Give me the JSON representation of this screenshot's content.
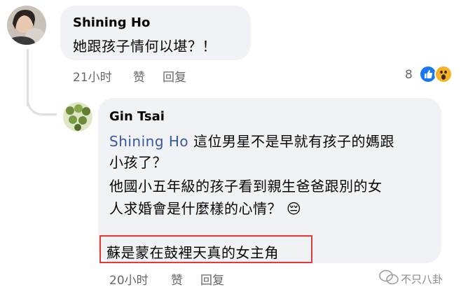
{
  "comments": [
    {
      "author": "Shining Ho",
      "text": "她跟孩子情何以堪？！",
      "time": "21小时",
      "like_label": "赞",
      "reply_label": "回复",
      "reaction_count": "8"
    }
  ],
  "reply": {
    "author": "Gin Tsai",
    "mention": "Shining Ho",
    "line1": " 這位男星不是早就有孩子的媽跟",
    "line2": "小孩了？",
    "line3": "他國小五年級的孩子看到親生爸爸跟別的女",
    "line4": "人求婚會是什麼樣的心情？",
    "emoji": "😔",
    "highlighted": "蘇是蒙在鼓裡天真的女主角",
    "time": "20小时",
    "like_label": "赞",
    "reply_label": "回复"
  },
  "watermark": "不只八卦",
  "colors": {
    "highlight_border": "#e53935",
    "like": "#1877f2",
    "wow": "#f7b125",
    "mention": "#385898"
  }
}
